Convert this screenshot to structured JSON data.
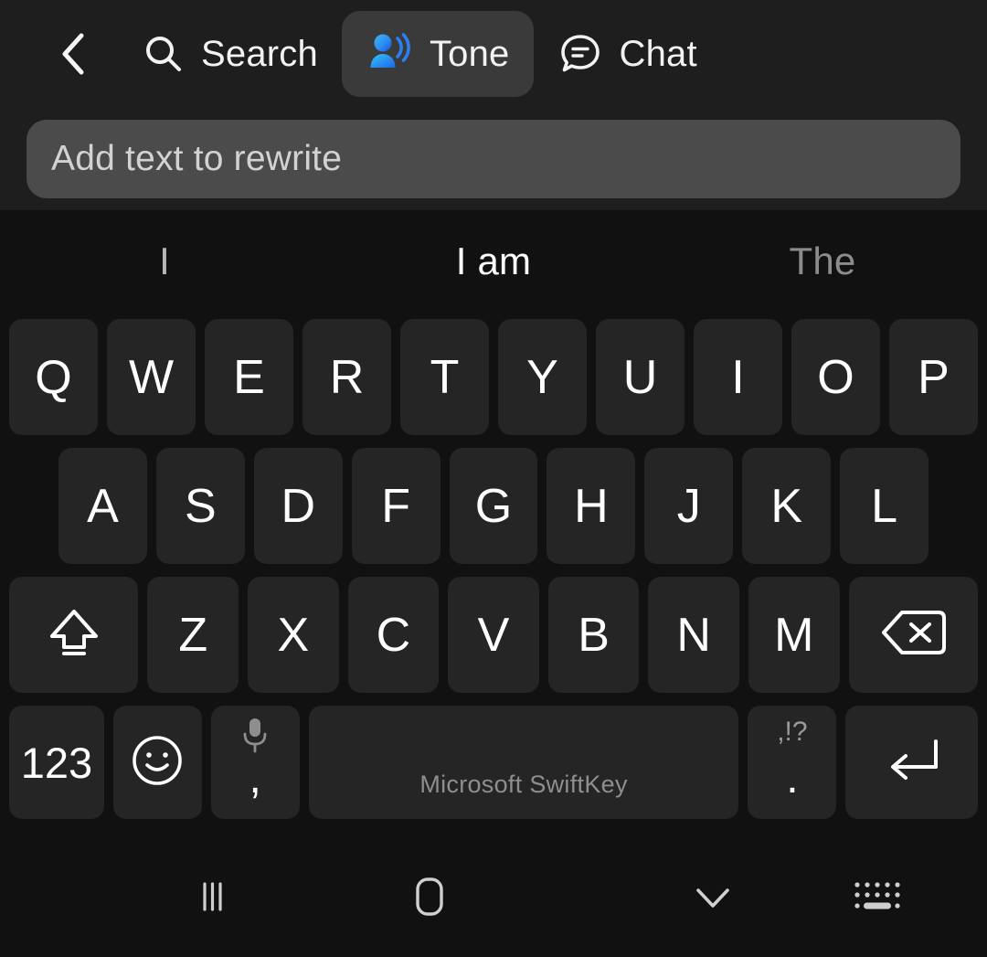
{
  "toolbar": {
    "back_icon": "chevron-left-icon",
    "tabs": [
      {
        "id": "search",
        "label": "Search",
        "icon": "search-icon",
        "active": false
      },
      {
        "id": "tone",
        "label": "Tone",
        "icon": "tone-person-waves-icon",
        "active": true
      },
      {
        "id": "chat",
        "label": "Chat",
        "icon": "chat-bubble-icon",
        "active": false
      }
    ]
  },
  "input": {
    "placeholder": "Add text to rewrite",
    "value": ""
  },
  "keyboard": {
    "suggestions": [
      {
        "text": "I",
        "emphasis": "dim"
      },
      {
        "text": "I am",
        "emphasis": "strong"
      },
      {
        "text": "The",
        "emphasis": "faint"
      }
    ],
    "row1": [
      "Q",
      "W",
      "E",
      "R",
      "T",
      "Y",
      "U",
      "I",
      "O",
      "P"
    ],
    "row2": [
      "A",
      "S",
      "D",
      "F",
      "G",
      "H",
      "J",
      "K",
      "L"
    ],
    "row3": {
      "shift_icon": "shift-arrow-icon",
      "letters": [
        "Z",
        "X",
        "C",
        "V",
        "B",
        "N",
        "M"
      ],
      "backspace_icon": "backspace-icon"
    },
    "row4": {
      "numeric_label": "123",
      "emoji_icon": "smiley-face-icon",
      "comma_primary": ",",
      "comma_secondary_icon": "microphone-icon",
      "space_label": "Microsoft SwiftKey",
      "period_primary": ".",
      "period_secondary": ",!?",
      "enter_icon": "enter-return-icon"
    }
  },
  "navbar": {
    "recents_icon": "recents-bars-icon",
    "home_icon": "home-square-icon",
    "hide_keyboard_icon": "chevron-down-icon",
    "switch_keyboard_icon": "keyboard-icon"
  },
  "colors": {
    "background": "#121212",
    "keyboard_bg": "#111111",
    "key_bg": "#252525",
    "input_bg": "#4b4b4b",
    "active_tab_bg": "#3a3a3a",
    "accent_blue_light": "#2fa7f5",
    "accent_blue_dark": "#1f4fd8"
  }
}
